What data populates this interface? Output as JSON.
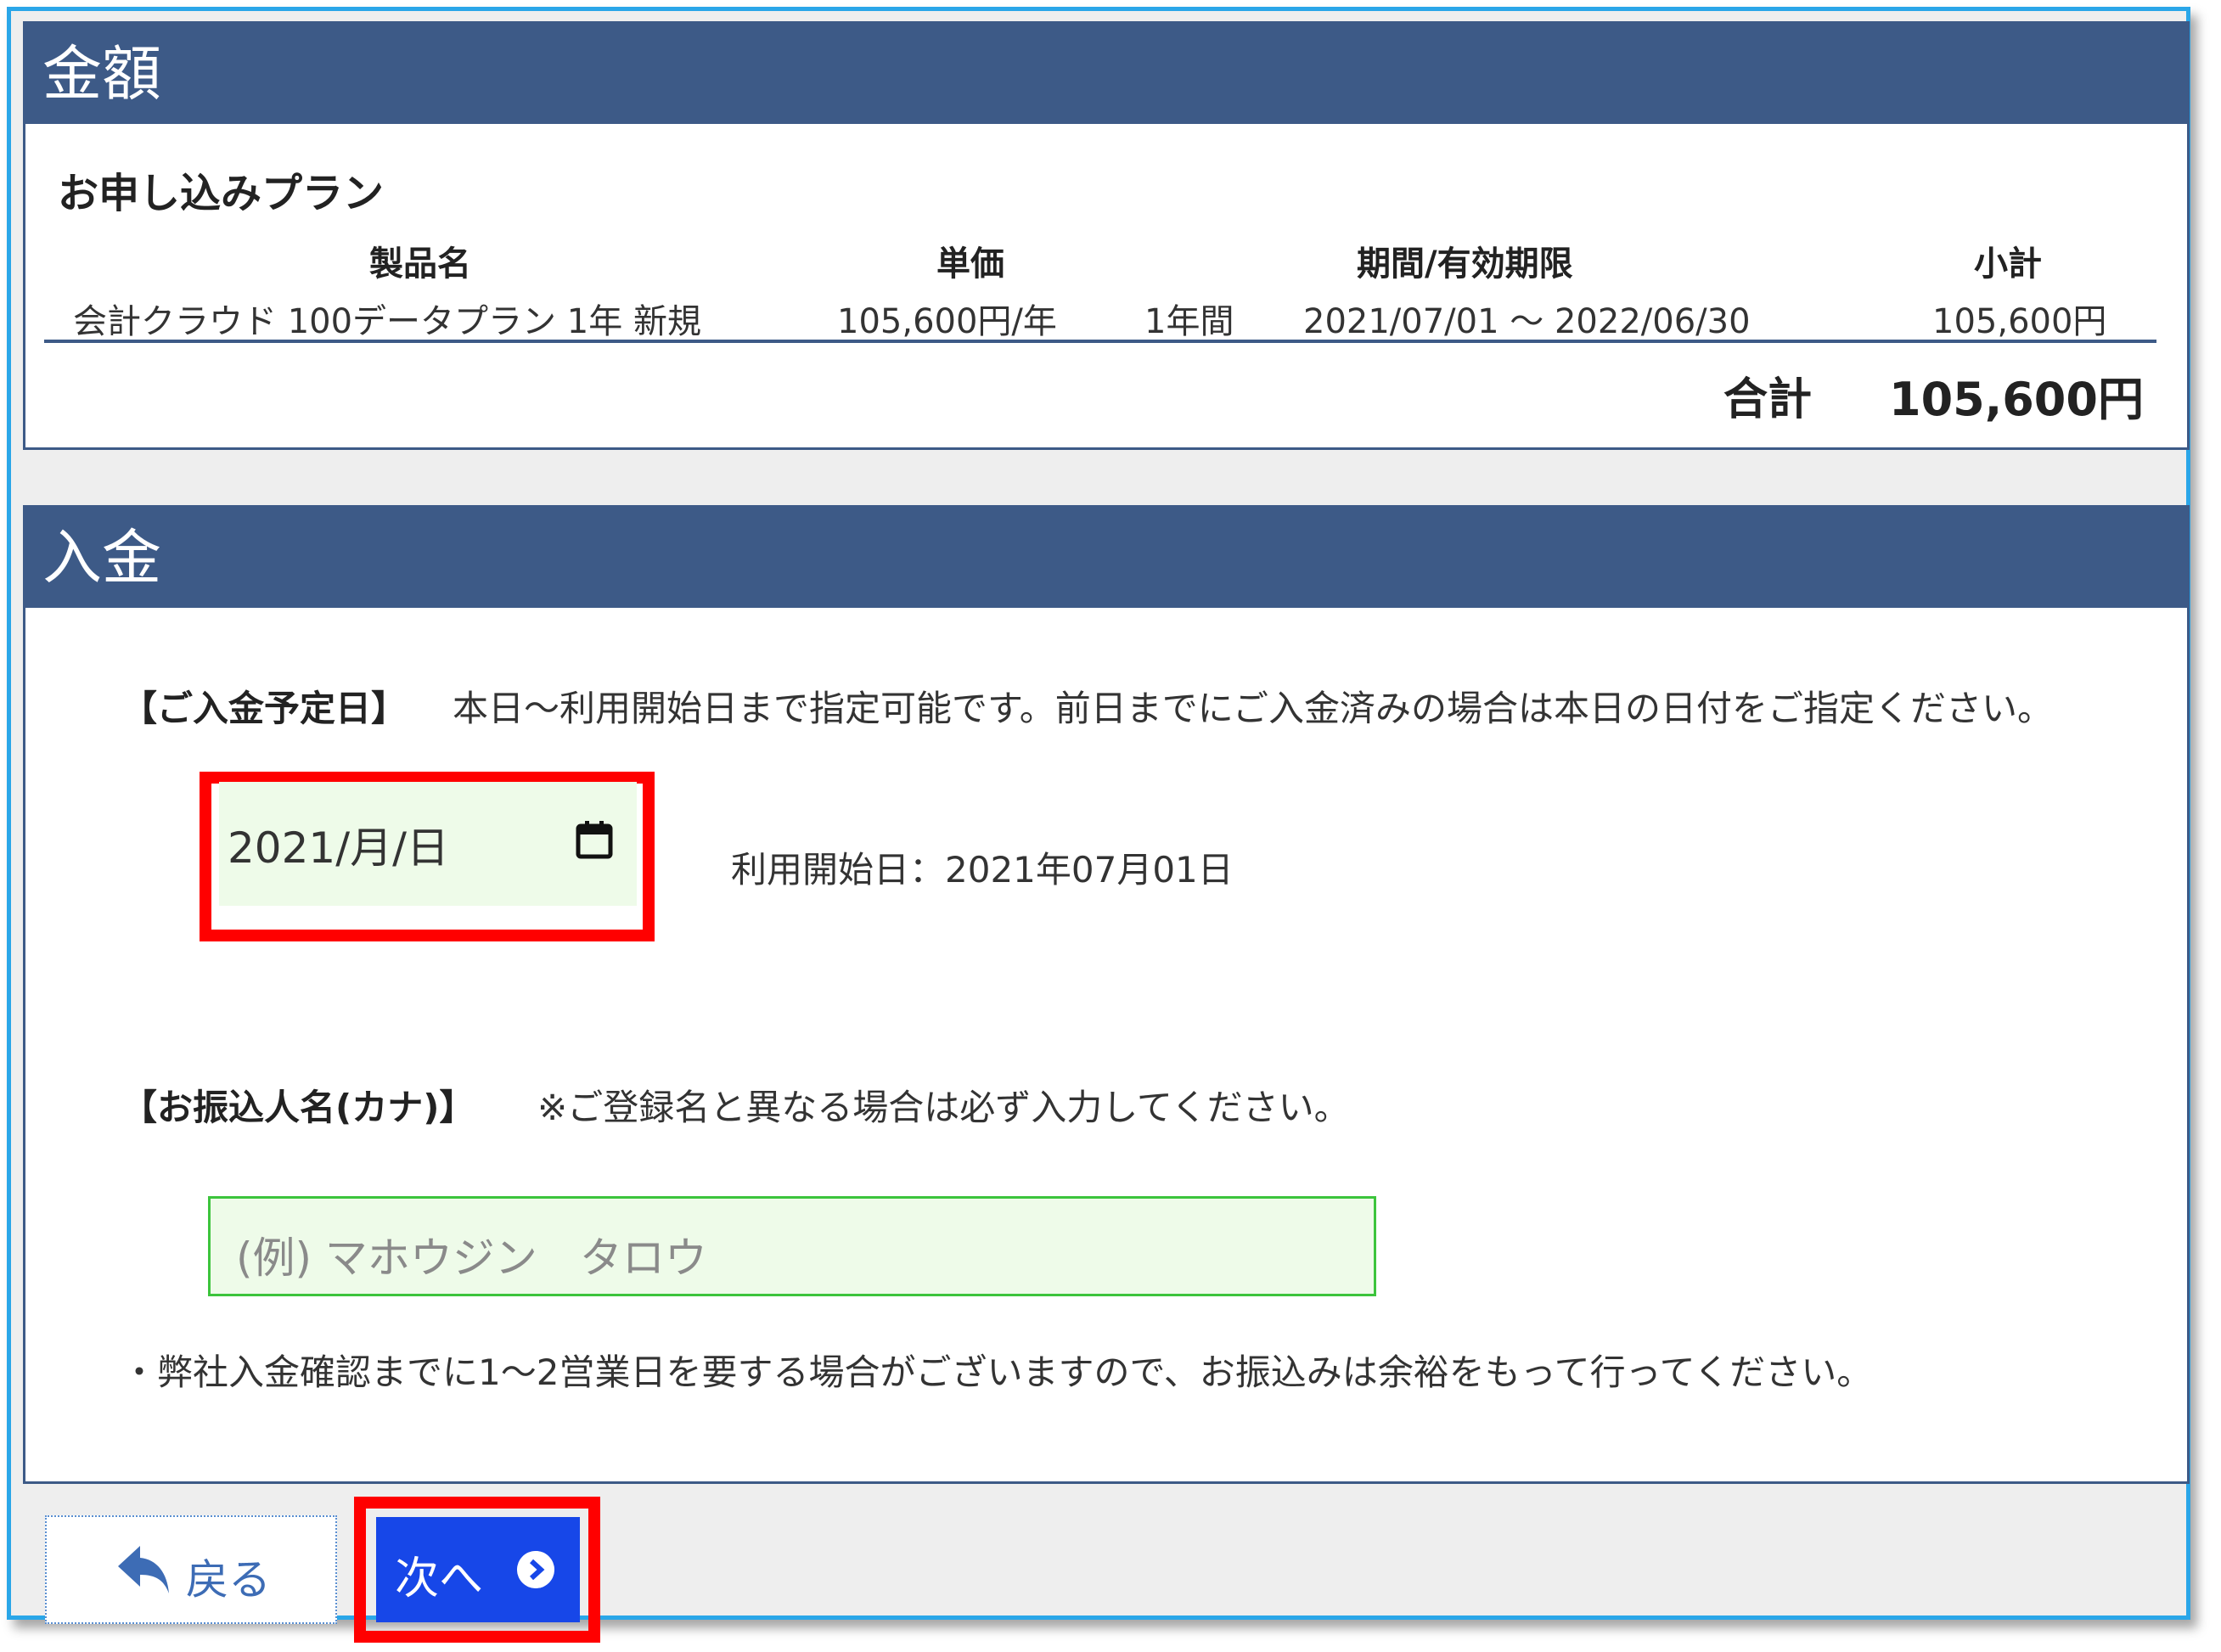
{
  "amount_section": {
    "header": "金額",
    "plan_title": "お申し込みプラン",
    "columns": [
      "製品名",
      "単価",
      "期間/有効期限",
      "小計"
    ],
    "row": {
      "product": "会計クラウド 100データプラン 1年 新規",
      "unit_price": "105,600円/年",
      "period": "1年間",
      "validity": "2021/07/01 ～ 2022/06/30",
      "subtotal": "105,600円"
    },
    "total_label": "合計",
    "total_value": "105,600円"
  },
  "payment_section": {
    "header": "入金",
    "date_label": "【ご入金予定日】",
    "date_note": "本日～利用開始日まで指定可能です。前日までにご入金済みの場合は本日の日付をご指定ください。",
    "date_value": "2021/月/日",
    "start_date_text": "利用開始日：2021年07月01日",
    "kana_label": "【お振込人名(カナ)】",
    "kana_note": "※ご登録名と異なる場合は必ず入力してください。",
    "kana_placeholder": "(例) マホウジン　タロウ",
    "footnote": "・弊社入金確認までに1～2営業日を要する場合がございますので、お振込みは余裕をもって行ってください。"
  },
  "buttons": {
    "back": "戻る",
    "next": "次へ"
  },
  "colors": {
    "header_bg": "#3d5a87",
    "highlight": "#ff0000",
    "next_button": "#1747e8",
    "input_bg": "#eefbe9"
  }
}
